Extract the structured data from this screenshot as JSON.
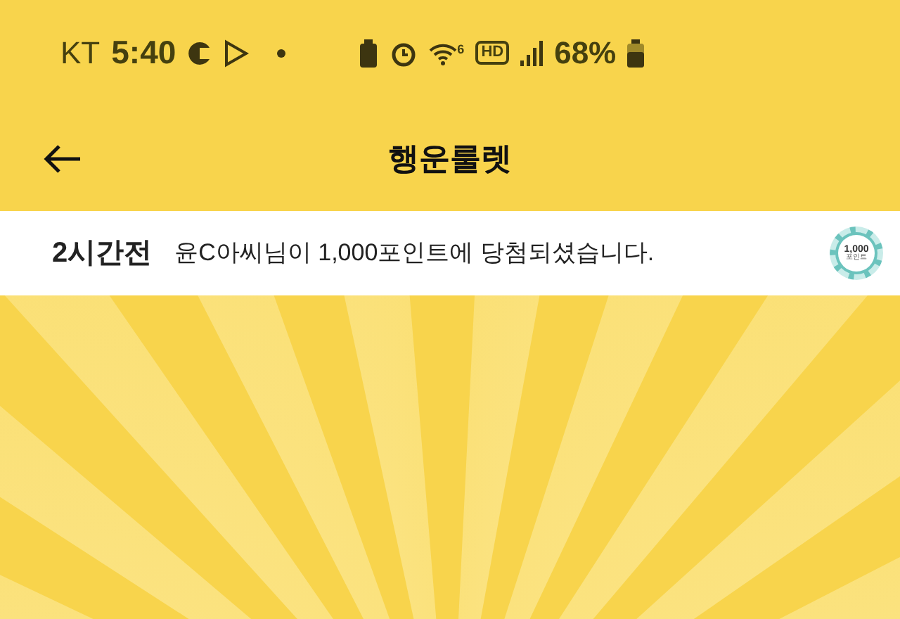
{
  "status_bar": {
    "carrier": "KT",
    "time": "5:40",
    "wifi_badge": "6",
    "hd_badge": "HD",
    "battery": "68%"
  },
  "header": {
    "title": "행운룰렛"
  },
  "ticker": {
    "time_ago": "2시간전",
    "message": "윤C아씨님이 1,000포인트에 당첨되셨습니다.",
    "chip_amount": "1,000",
    "chip_unit": "포인트"
  }
}
